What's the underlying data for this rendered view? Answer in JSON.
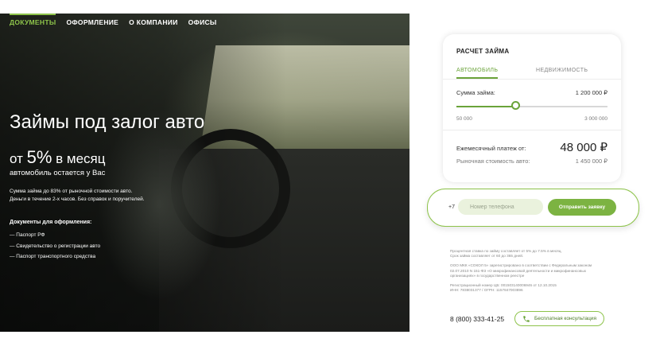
{
  "nav": {
    "items": [
      {
        "label": "ДОКУМЕНТЫ",
        "active": true
      },
      {
        "label": "ОФОРМЛЕНИЕ",
        "active": false
      },
      {
        "label": "О КОМПАНИИ",
        "active": false
      },
      {
        "label": "ОФИСЫ",
        "active": false
      }
    ]
  },
  "hero": {
    "title": "Займы под залог авто",
    "rate_prefix": "от",
    "rate_value": "5%",
    "rate_suffix": "в месяц",
    "subtitle": "автомобиль остается у Вас",
    "desc_line1": "Сумма займа до 83% от рыночной стоимости авто.",
    "desc_line2": "Деньги в течение 2-х часов. Без справок и поручителей.",
    "docs_title": "Документы для оформления:",
    "docs": [
      "— Паспорт РФ",
      "— Свидетельство о регистрации авто",
      "— Паспорт транспортного средства"
    ]
  },
  "calc": {
    "title": "РАСЧЕТ ЗАЙМА",
    "tabs": [
      {
        "label": "АВТОМОБИЛЬ",
        "active": true
      },
      {
        "label": "НЕДВИЖИМОСТЬ",
        "active": false
      }
    ],
    "amount_label": "Сумма займа:",
    "amount_value": "1 200 000 ₽",
    "slider_min": "50 000",
    "slider_max": "3 000 000",
    "slider_fraction": 0.39,
    "monthly_label": "Ежемесячный платеж от:",
    "monthly_value": "48 000 ₽",
    "market_label": "Рыночная стоимость авто:",
    "market_value": "1 450 000 ₽"
  },
  "form": {
    "prefix": "+7",
    "phone_placeholder": "Номер телефона",
    "phone_value": "",
    "submit_label": "Отправить заявку"
  },
  "disclaimer": {
    "p1_line1": "Процентная ставка по займу составляет от 5% до 7.5% в месяц.",
    "p1_line2": "Срок займа составляет от 60 до 365 дней.",
    "p2_line1": "ООО МКК «СОКОЛ 5» зарегистрировано в соответствии с Федеральным законом",
    "p2_line2": "02.07.2010 N 151-ФЗ «О микрофинансовой деятельности и микрофинансовых",
    "p2_line3": "организациях» в государственном реестре",
    "p3_line1": "Регистрационный номер ЦБ: 001503140006946 от 12.10.2015",
    "p3_line2": "ИНН: 7838031377 / ОГРН: 1157847003896"
  },
  "footer": {
    "phone": "8 (800) 333-41-25",
    "consult_label": "Бесплатная консультация",
    "consult_icon": "phone-icon"
  },
  "colors": {
    "accent": "#8dc34a",
    "accent_dark": "#6aa33a",
    "button": "#7cb342"
  }
}
